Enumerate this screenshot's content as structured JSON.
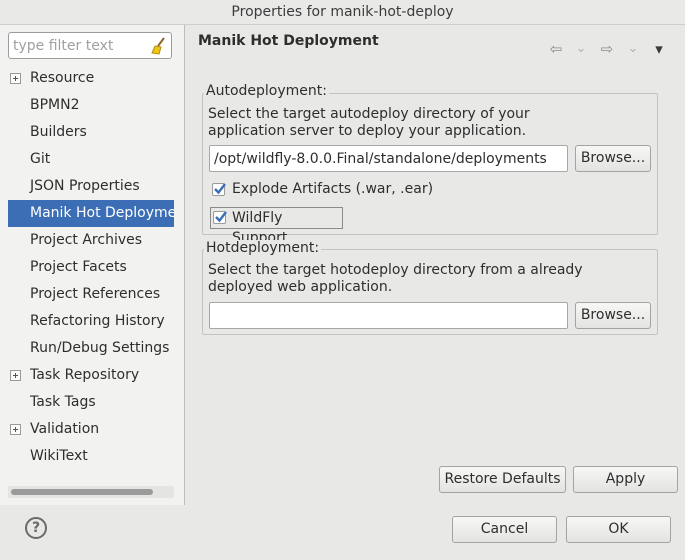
{
  "window": {
    "title": "Properties for manik-hot-deploy"
  },
  "filter": {
    "placeholder": "type filter text",
    "value": ""
  },
  "tree": {
    "items": [
      {
        "label": "Resource",
        "expandable": true
      },
      {
        "label": "BPMN2",
        "expandable": false
      },
      {
        "label": "Builders",
        "expandable": false
      },
      {
        "label": "Git",
        "expandable": false
      },
      {
        "label": "JSON Properties",
        "expandable": false
      },
      {
        "label": "Manik Hot Deployme",
        "expandable": false,
        "selected": true
      },
      {
        "label": "Project Archives",
        "expandable": false
      },
      {
        "label": "Project Facets",
        "expandable": false
      },
      {
        "label": "Project References",
        "expandable": false
      },
      {
        "label": "Refactoring History",
        "expandable": false
      },
      {
        "label": "Run/Debug Settings",
        "expandable": false
      },
      {
        "label": "Task Repository",
        "expandable": true
      },
      {
        "label": "Task Tags",
        "expandable": false
      },
      {
        "label": "Validation",
        "expandable": true
      },
      {
        "label": "WikiText",
        "expandable": false
      }
    ]
  },
  "page": {
    "title": "Manik Hot Deployment"
  },
  "nav": {
    "back_icon": "⇦",
    "forward_icon": "⇨",
    "dropdown_icon": "⌄",
    "menu_icon": "▾"
  },
  "autodeployment": {
    "legend": "Autodeployment:",
    "description_line1": "Select the target autodeploy directory of your",
    "description_line2": "application server to deploy your application.",
    "path_value": "/opt/wildfly-8.0.0.Final/standalone/deployments",
    "browse_label": "Browse...",
    "explode_label": "Explode Artifacts (.war, .ear)",
    "explode_checked": true,
    "wildfly_label": "WildFly Support",
    "wildfly_checked": true
  },
  "hotdeployment": {
    "legend": "Hotdeployment:",
    "description_line1": "Select the target hotodeploy directory from a already",
    "description_line2": "deployed web application.",
    "path_value": "",
    "browse_label": "Browse..."
  },
  "actions": {
    "restore_label": "Restore Defaults",
    "apply_label": "Apply"
  },
  "footer": {
    "help_icon": "?",
    "cancel_label": "Cancel",
    "ok_label": "OK"
  },
  "colors": {
    "selection": "#3b6eb4",
    "background": "#e8e8e7",
    "check": "#3b6eb4"
  }
}
